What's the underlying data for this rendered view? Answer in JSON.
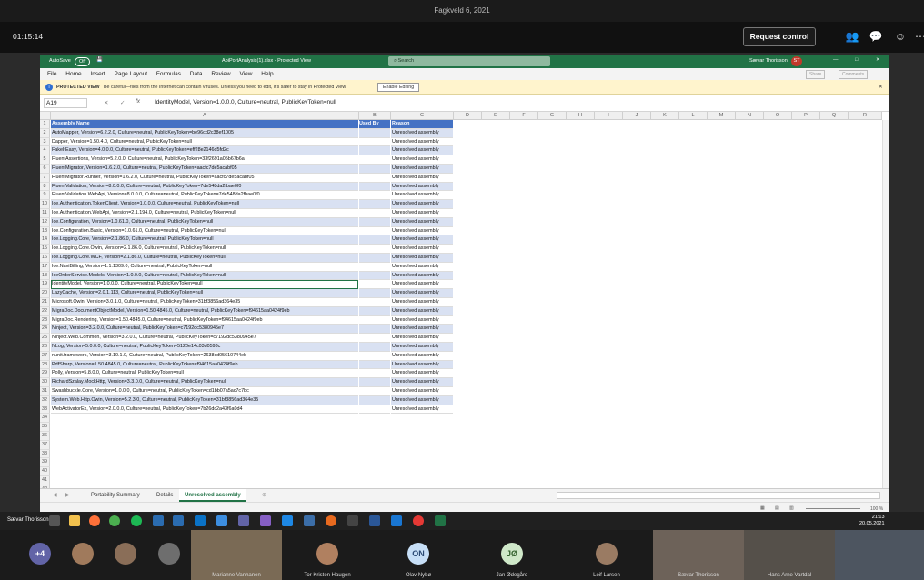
{
  "teams": {
    "meeting_title": "Fagkveld 6, 2021",
    "timer": "01:15:14",
    "request_control": "Request control"
  },
  "excel": {
    "autosave_label": "AutoSave",
    "autosave_state": "Off",
    "filename": "ApiPortAnalysis(1).xlsx - Protected View",
    "search_placeholder": "Search",
    "user_name": "Sævar Thorisson",
    "user_initials": "ST",
    "share_label": "Share",
    "comments_label": "Comments",
    "menu": [
      "File",
      "Home",
      "Insert",
      "Page Layout",
      "Formulas",
      "Data",
      "Review",
      "View",
      "Help"
    ],
    "protected_title": "PROTECTED VIEW",
    "protected_msg": "Be careful—files from the Internet can contain viruses. Unless you need to edit, it's safer to stay in Protected View.",
    "enable_editing": "Enable Editing",
    "name_box": "A19",
    "formula": "IdentityModel, Version=1.0.0.0, Culture=neutral, PublicKeyToken=null",
    "columns": [
      "A",
      "B",
      "C",
      "D",
      "E",
      "F",
      "G",
      "H",
      "I",
      "J",
      "K",
      "L",
      "M",
      "N",
      "O",
      "P",
      "Q",
      "R"
    ],
    "headers": {
      "a": "Assembly Name",
      "b": "Used By",
      "c": "Reason"
    },
    "rows": [
      "AutoMapper, Version=6.2.2.0, Culture=neutral, PublicKeyToken=be96cd2c38ef1005",
      "Dapper, Version=1.50.4.0, Culture=neutral, PublicKeyToken=null",
      "FakeItEasy, Version=4.0.0.0, Culture=neutral, PublicKeyToken=eff28e2146d5fd2c",
      "FluentAssertions, Version=5.2.0.0, Culture=neutral, PublicKeyToken=33f2691a05b67b6a",
      "FluentMigrator, Version=1.6.2.0, Culture=neutral, PublicKeyToken=aacfc7de5acabf05",
      "FluentMigrator.Runner, Version=1.6.2.0, Culture=neutral, PublicKeyToken=aacfc7de5acabf05",
      "FluentValidation, Version=8.0.0.0, Culture=neutral, PublicKeyToken=7de548da2fbae0f0",
      "FluentValidation.WebApi, Version=8.0.0.0, Culture=neutral, PublicKeyToken=7de548da2fbae0f0",
      "Ice.Authentication.TokenClient, Version=1.0.0.0, Culture=neutral, PublicKeyToken=null",
      "Ice.Authentication.WebApi, Version=2.1.194.0, Culture=neutral, PublicKeyToken=null",
      "Ice.Configuration, Version=1.0.61.0, Culture=neutral, PublicKeyToken=null",
      "Ice.Configuration.Basic, Version=1.0.61.0, Culture=neutral, PublicKeyToken=null",
      "Ice.Logging.Core, Version=2.1.86.0, Culture=neutral, PublicKeyToken=null",
      "Ice.Logging.Core.Owin, Version=2.1.86.0, Culture=neutral, PublicKeyToken=null",
      "Ice.Logging.Core.WCF, Version=2.1.86.0, Culture=neutral, PublicKeyToken=null",
      "Ice.NaviBilling, Version=1.1.1309.0, Culture=neutral, PublicKeyToken=null",
      "IceOrderService.Models, Version=1.0.0.0, Culture=neutral, PublicKeyToken=null",
      "IdentityModel, Version=1.0.0.0, Culture=neutral, PublicKeyToken=null",
      "LazyCache, Version=2.0.1.113, Culture=neutral, PublicKeyToken=null",
      "Microsoft.Owin, Version=3.0.1.0, Culture=neutral, PublicKeyToken=31bf3856ad364e35",
      "MigraDoc.DocumentObjectModel, Version=1.50.4845.0, Culture=neutral, PublicKeyToken=f94615aa0424f9eb",
      "MigraDoc.Rendering, Version=1.50.4845.0, Culture=neutral, PublicKeyToken=f94615aa0424f9eb",
      "Ninject, Version=3.2.0.0, Culture=neutral, PublicKeyToken=c7192dc5380945e7",
      "Ninject.Web.Common, Version=3.2.0.0, Culture=neutral, PublicKeyToken=c7192dc5380945e7",
      "NLog, Version=5.0.0.0, Culture=neutral, PublicKeyToken=5120e14c03d0593c",
      "nunit.framework, Version=3.10.1.0, Culture=neutral, PublicKeyToken=2638cd05610744eb",
      "PdfSharp, Version=1.50.4845.0, Culture=neutral, PublicKeyToken=f94615aa0424f9eb",
      "Polly, Version=5.8.0.0, Culture=neutral, PublicKeyToken=null",
      "RichardSzalay.MockHttp, Version=3.3.0.0, Culture=neutral, PublicKeyToken=null",
      "Swashbuckle.Core, Version=1.0.0.0, Culture=neutral, PublicKeyToken=cd1bb07a5ac7c7bc",
      "System.Web.Http.Owin, Version=5.2.3.0, Culture=neutral, PublicKeyToken=31bf3856ad364e35",
      "WebActivatorEx, Version=2.0.0.0, Culture=neutral, PublicKeyToken=7b26dc2a43f6a0d4"
    ],
    "reason": "Unresolved assembly",
    "empty_rows": [
      "34",
      "35",
      "36",
      "37",
      "38",
      "39",
      "40",
      "41",
      "42"
    ],
    "sheets": [
      "Portability Summary",
      "Details",
      "Unresolved assembly"
    ],
    "zoom": "100 %"
  },
  "taskbar": {
    "name": "Sævar Thorisson",
    "time": "21:13",
    "date": "20.05.2021"
  },
  "participants": [
    {
      "name": "+4",
      "type": "more"
    },
    {
      "name": "",
      "type": "photo"
    },
    {
      "name": "",
      "type": "photo"
    },
    {
      "name": "",
      "type": "photo"
    },
    {
      "name": "Marianne Vanhanen",
      "type": "video"
    },
    {
      "name": "Tor Kristen Haugen",
      "type": "photo"
    },
    {
      "name": "Olav Nybø",
      "type": "initials",
      "initials": "ON",
      "color": "#c7dff7"
    },
    {
      "name": "Jan Ødegård",
      "type": "initials",
      "initials": "JØ",
      "color": "#cfe8c9"
    },
    {
      "name": "Leif Larsen",
      "type": "photo"
    },
    {
      "name": "Sævar Thorisson",
      "type": "video"
    },
    {
      "name": "Hans Arne Vartdal",
      "type": "video"
    },
    {
      "name": "",
      "type": "video"
    }
  ]
}
